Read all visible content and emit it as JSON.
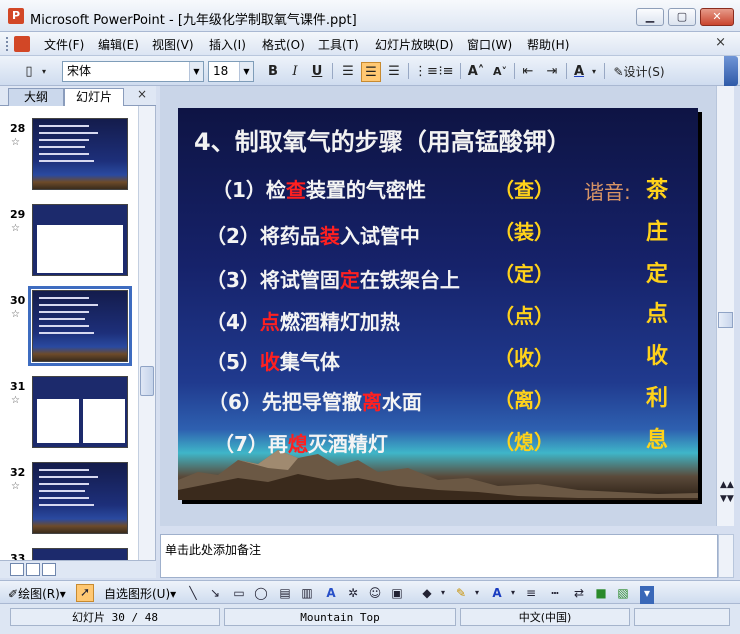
{
  "window": {
    "title": "Microsoft PowerPoint - [九年级化学制取氧气课件.ppt]"
  },
  "menu": {
    "items": [
      "文件(F)",
      "编辑(E)",
      "视图(V)",
      "插入(I)",
      "格式(O)",
      "工具(T)",
      "幻灯片放映(D)",
      "窗口(W)",
      "帮助(H)"
    ],
    "close": "×"
  },
  "toolbar": {
    "font": "宋体",
    "size": "18",
    "bold": "B",
    "italic": "I",
    "underline": "U",
    "design": "设计(S)"
  },
  "panel": {
    "tabs": [
      "大纲",
      "幻灯片"
    ],
    "close": "×"
  },
  "thumbnails": [
    {
      "num": "28"
    },
    {
      "num": "29"
    },
    {
      "num": "30"
    },
    {
      "num": "31"
    },
    {
      "num": "32"
    },
    {
      "num": "33"
    }
  ],
  "slide": {
    "title": "4、制取氧气的步骤（用高锰酸钾）",
    "steps": [
      {
        "pre": "（1）检",
        "hl": "查",
        "post": "装置的气密性",
        "abbr": "（查）"
      },
      {
        "pre": "（2）将药品",
        "hl": "装",
        "post": "入试管中",
        "abbr": "（装）"
      },
      {
        "pre": "（3）将试管固",
        "hl": "定",
        "post": "在铁架台上",
        "abbr": "（定）"
      },
      {
        "pre": "（4）",
        "hl": "点",
        "post": "燃酒精灯加热",
        "abbr": "（点）"
      },
      {
        "pre": "（5）",
        "hl": "收",
        "post": "集气体",
        "abbr": "（收）"
      },
      {
        "pre": "（6）先把导管撤",
        "hl": "离",
        "post": "水面",
        "abbr": "（离）"
      },
      {
        "pre": "（7）再",
        "hl": "熄",
        "post": "灭酒精灯",
        "abbr": "（熄）"
      }
    ],
    "mnemonic_label": "谐音:",
    "mnemonic_chars": [
      "茶",
      "庄",
      "定",
      "点",
      "收",
      "利",
      "息"
    ]
  },
  "notes": {
    "placeholder": "单击此处添加备注"
  },
  "drawbar": {
    "draw": "绘图(R)",
    "autoshape": "自选图形(U)"
  },
  "status": {
    "slide": "幻灯片 30 / 48",
    "design": "Mountain Top",
    "language": "中文(中国)"
  }
}
